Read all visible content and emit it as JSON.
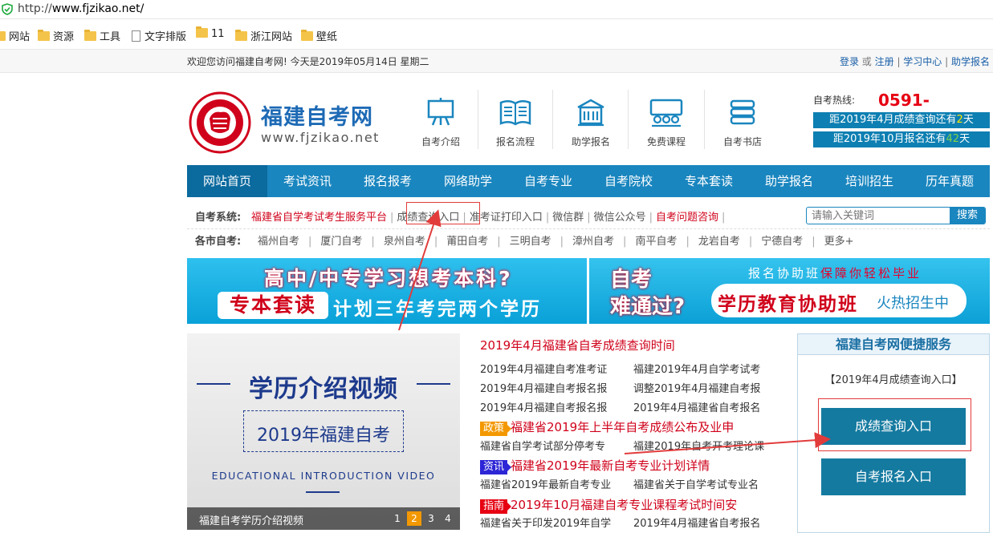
{
  "browser": {
    "url_prefix": "http://",
    "url_host": "www.fjzikao.net/",
    "bookmarks": [
      {
        "label": "网站",
        "icon": "folder-icon"
      },
      {
        "label": "资源",
        "icon": "folder-icon"
      },
      {
        "label": "工具",
        "icon": "folder-icon"
      },
      {
        "label": "文字排版",
        "icon": "document-icon"
      },
      {
        "label": "11",
        "icon": "folder-icon"
      },
      {
        "label": "浙江网站",
        "icon": "folder-icon"
      },
      {
        "label": "壁纸",
        "icon": "folder-icon"
      }
    ]
  },
  "topbar": {
    "welcome": "欢迎您访问福建自考网! 今天是2019年05月14日 星期二",
    "login": "登录",
    "or": " 或 ",
    "register": "注册",
    "study_center": "学习中心",
    "assist_signup": "助学报名"
  },
  "header": {
    "site_name": "福建自考网",
    "site_url": "www.fjzikao.net",
    "icons": [
      {
        "label": "自考介绍",
        "icon": "presentation-board-icon"
      },
      {
        "label": "报名流程",
        "icon": "open-book-icon"
      },
      {
        "label": "助学报名",
        "icon": "school-building-icon"
      },
      {
        "label": "免费课程",
        "icon": "classroom-icon"
      },
      {
        "label": "自考书店",
        "icon": "book-stack-icon"
      }
    ],
    "hotline_label": "自考热线:",
    "hotline": "0591-87666380",
    "countdown1_pre": "距2019年4月成绩查询还有",
    "countdown1_num": "2",
    "countdown1_unit": "天",
    "countdown2_pre": "距2019年10月报名还有",
    "countdown2_num": "42",
    "countdown2_unit": "天",
    "accent_color": "#1a86bf",
    "hotline_color": "#e60012"
  },
  "nav": [
    "网站首页",
    "考试资讯",
    "报名报考",
    "网络助学",
    "自考专业",
    "自考院校",
    "专本套读",
    "助学报名",
    "培训招生",
    "历年真题"
  ],
  "system_row": {
    "title": "自考系统:",
    "items": [
      {
        "label": "福建省自学考试考生服务平台",
        "red": true
      },
      {
        "label": "成绩查询入口",
        "red": false
      },
      {
        "label": "准考证打印入口",
        "red": false
      },
      {
        "label": "微信群",
        "red": false
      },
      {
        "label": "微信公众号",
        "red": false
      },
      {
        "label": "自考问题咨询",
        "red": true
      }
    ],
    "search_placeholder": "请输入关键词",
    "search_button": "搜索"
  },
  "city_row": {
    "title": "各市自考:",
    "items": [
      "福州自考",
      "厦门自考",
      "泉州自考",
      "莆田自考",
      "三明自考",
      "漳州自考",
      "南平自考",
      "龙岩自考",
      "宁德自考",
      "更多+"
    ]
  },
  "banner_left": {
    "line1": "高中/中专学习想考本科?",
    "tag": "专本套读",
    "line2": "计划三年考完两个学历"
  },
  "banner_right": {
    "big1": "自考",
    "big2": "难通过?",
    "sub_pre": "报名协助班",
    "sub_em": "保障你轻松毕业",
    "main": "学历教育协助班",
    "hot": "火热招生中"
  },
  "video": {
    "title": "学历介绍视频",
    "year_text": "2019年福建自考",
    "english": "EDUCATIONAL INTRODUCTION VIDEO",
    "caption": "福建自考学历介绍视频",
    "pages": [
      "1",
      "2",
      "3",
      "4"
    ],
    "active_page": "2"
  },
  "news": {
    "headline": "2019年4月福建省自考成绩查询时间",
    "rows": [
      [
        "2019年4月福建自考准考证",
        "福建2019年4月自学考试考"
      ],
      [
        "2019年4月福建自考报名报",
        "调整2019年4月福建自考报"
      ],
      [
        "2019年4月福建自考报名报",
        "2019年4月福建省自考报名"
      ]
    ],
    "groups": [
      {
        "badge": "政策",
        "headline": "福建省2019年上半年自考成绩公布及业申",
        "links": [
          "福建省自学考试部分停考专",
          "福建2019年自考开考理论课"
        ]
      },
      {
        "badge": "资讯",
        "headline": "福建省2019年最新自考专业计划详情",
        "links": [
          "福建省2019年最新自考专业",
          "福建省关于自学考试专业名"
        ]
      },
      {
        "badge": "指南",
        "headline": "2019年10月福建自考专业课程考试时间安",
        "links": [
          "福建省关于印发2019年自学",
          "2019年4月福建省自考报名"
        ]
      }
    ]
  },
  "service": {
    "title": "福建自考网便捷服务",
    "subtitle": "【2019年4月成绩查询入口】",
    "btn1": "成绩查询入口",
    "btn2": "自考报名入口"
  }
}
